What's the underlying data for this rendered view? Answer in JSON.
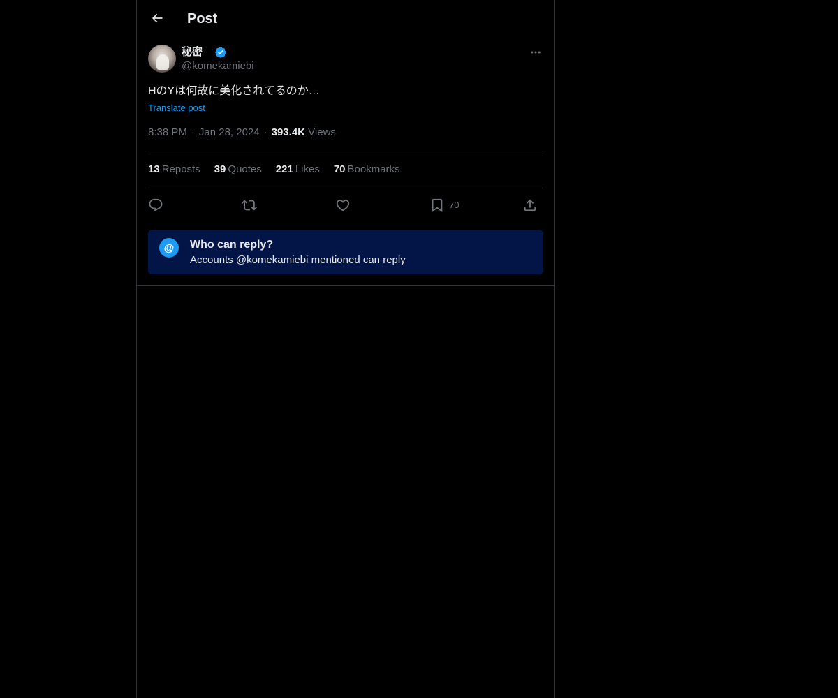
{
  "header": {
    "title": "Post",
    "back_icon": "arrow-left-icon"
  },
  "post": {
    "author": {
      "display_name": "秘密",
      "handle": "@komekamiebi",
      "verified": true,
      "verified_color": "#1d9bf0"
    },
    "text": "HのYは何故に美化されてるのか…",
    "translate_label": "Translate post",
    "time": "8:38 PM",
    "date": "Jan 28, 2024",
    "views_count": "393.4K",
    "views_label": "Views",
    "separator": "·"
  },
  "stats": {
    "reposts": {
      "count": "13",
      "label": "Reposts"
    },
    "quotes": {
      "count": "39",
      "label": "Quotes"
    },
    "likes": {
      "count": "221",
      "label": "Likes"
    },
    "bookmarks": {
      "count": "70",
      "label": "Bookmarks"
    }
  },
  "actions": {
    "reply_icon": "reply-icon",
    "repost_icon": "repost-icon",
    "like_icon": "heart-icon",
    "bookmark_icon": "bookmark-icon",
    "bookmark_count": "70",
    "share_icon": "share-icon"
  },
  "reply_restriction": {
    "icon_glyph": "@",
    "title": "Who can reply?",
    "description": "Accounts @komekamiebi mentioned can reply",
    "background_color": "#031547",
    "icon_color": "#1d9bf0"
  },
  "colors": {
    "background": "#000000",
    "text_primary": "#e7e9ea",
    "text_secondary": "#71767b",
    "accent": "#1d9bf0",
    "border": "#2f3336"
  }
}
